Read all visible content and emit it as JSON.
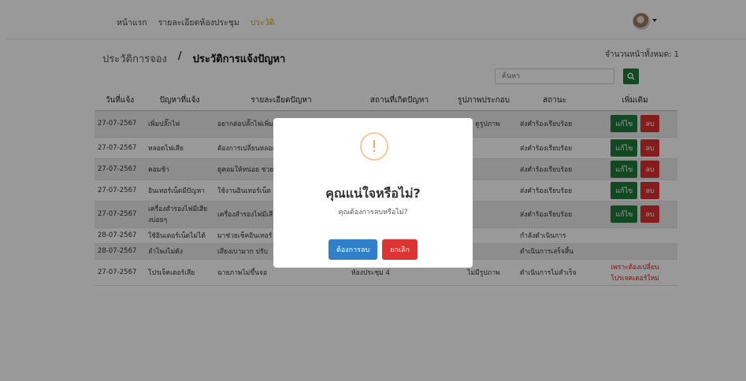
{
  "nav": {
    "items": [
      {
        "label": "หน้าแรก",
        "active": false
      },
      {
        "label": "รายละเอียดห้องประชุม",
        "active": false
      },
      {
        "label": "ประวัติ",
        "active": true
      }
    ]
  },
  "breadcrumb": {
    "first": "ประวัติการจอง",
    "separator": "/",
    "current": "ประวัติการแจ้งปัญหา"
  },
  "page_count": "จำนวนหน้าทั้งหมด: 1",
  "search": {
    "placeholder": "ค้นหา",
    "icon": "search-icon"
  },
  "table": {
    "headers": [
      "วันที่แจ้ง",
      "ปัญหาที่แจ้ง",
      "รายละเอียดปัญหา",
      "สถานที่เกิดปัญหา",
      "รูปภาพประกอบ",
      "สถานะ",
      "เพิ่มเติม"
    ],
    "edit_label": "แก้ไข",
    "delete_label": "ลบ",
    "rows": [
      {
        "date": "27-07-2567",
        "issue": "เพิ่มปลั๊กไฟ",
        "detail": "อยากต่อปลั๊กไฟเพิ่ม ไม่เพียงพอต่อการใช้งาน",
        "place": "ห้องทรัพยากรบุคคล",
        "image": "ดูรูปภาพ",
        "status": "ส่งคำร้องเรียบร้อย",
        "status_type": "ok",
        "actions": true
      },
      {
        "date": "27-07-2567",
        "issue": "หลอดไฟเสีย",
        "detail": "ต้องการเปลี่ยนหลอดไฟ",
        "place": "",
        "image": "",
        "status": "ส่งคำร้องเรียบร้อย",
        "status_type": "ok",
        "actions": true
      },
      {
        "date": "27-07-2567",
        "issue": "คอมช้า",
        "detail": "ดูคอมให้หน่อย ช่วย",
        "place": "",
        "image": "",
        "status": "ส่งคำร้องเรียบร้อย",
        "status_type": "ok",
        "actions": true
      },
      {
        "date": "27-07-2567",
        "issue": "อินเทอร์เน็ตมีปัญหา",
        "detail": "ใช้งานอินเทอร์เน็ต",
        "place": "",
        "image": "",
        "status": "ส่งคำร้องเรียบร้อย",
        "status_type": "ok",
        "actions": true
      },
      {
        "date": "27-07-2567",
        "issue": "เครื่องสำรองไฟมีเสียงบ่อยๆ",
        "detail": "เครื่องสำรองไฟมีเสียง ไม่ดัง",
        "place": "",
        "image": "",
        "status": "ส่งคำร้องเรียบร้อย",
        "status_type": "ok",
        "actions": true
      },
      {
        "date": "28-07-2567",
        "issue": "ใช้อินเตอร์เน็ตไม่ได้",
        "detail": "มาช่วยเช็คอินเทอร์",
        "place": "",
        "image": "",
        "status": "กำลังดำเนินการ",
        "status_type": "prog",
        "actions": false,
        "extra": ""
      },
      {
        "date": "28-07-2567",
        "issue": "ลำโพงไม่ดัง",
        "detail": "เสียงเบามาก ปรับ",
        "place": "",
        "image": "",
        "status": "ดำเนินการเสร็จสิ้น",
        "status_type": "done",
        "actions": false,
        "extra": ""
      },
      {
        "date": "27-07-2567",
        "issue": "โปรเจ็คเตอร์เสีย",
        "detail": "ฉายภาพไม่ขึ้นจอ",
        "place": "ห้องประชุม 4",
        "image": "ไม่มีรูปภาพ",
        "status": "ดำเนินการไม่สำเร็จ",
        "status_type": "fail",
        "actions": false,
        "extra": "เพราะต้องเปลี่ยนโปรเจคเตอร์ใหม่"
      }
    ]
  },
  "modal": {
    "icon": "exclamation-icon",
    "title": "คุณแน่ใจหรือไม่?",
    "text": "คุณต้องการลบหรือไม่?",
    "confirm_label": "ต้องการลบ",
    "cancel_label": "ยกเลิก"
  },
  "colors": {
    "accent_green": "#1f7a3a",
    "danger_red": "#d33333",
    "confirm_blue": "#2f80c8",
    "active_nav": "#d6a32b",
    "warning_orange": "#f0a85e"
  }
}
